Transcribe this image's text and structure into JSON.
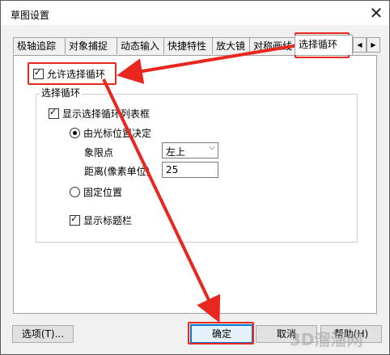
{
  "window": {
    "title": "草图设置",
    "close_glyph": "✕"
  },
  "tabs": [
    {
      "label": "极轴追踪"
    },
    {
      "label": "对象捕捉"
    },
    {
      "label": "动态输入"
    },
    {
      "label": "快捷特性"
    },
    {
      "label": "放大镜"
    },
    {
      "label": "对称画线"
    },
    {
      "label": "选择循环",
      "active": true
    }
  ],
  "tab_scroll": {
    "left": "◀",
    "right": "▶"
  },
  "options": {
    "allow_cycling": "允许选择循环",
    "group_title": "选择循环",
    "show_list": "显示选择循环列表框",
    "by_cursor": "由光标位置决定",
    "quadrant_label": "象限点",
    "quadrant_value": "左上",
    "distance_label": "距离(像素单位)",
    "distance_value": "25",
    "fixed_position": "固定位置",
    "show_titlebar": "显示标题栏"
  },
  "buttons": {
    "options": "选项(T)...",
    "ok": "确定",
    "cancel": "取消",
    "help": "帮助(H)"
  },
  "watermark": "3D溜溜网",
  "colors": {
    "highlight": "#e8271f",
    "focus": "#0078d7"
  }
}
